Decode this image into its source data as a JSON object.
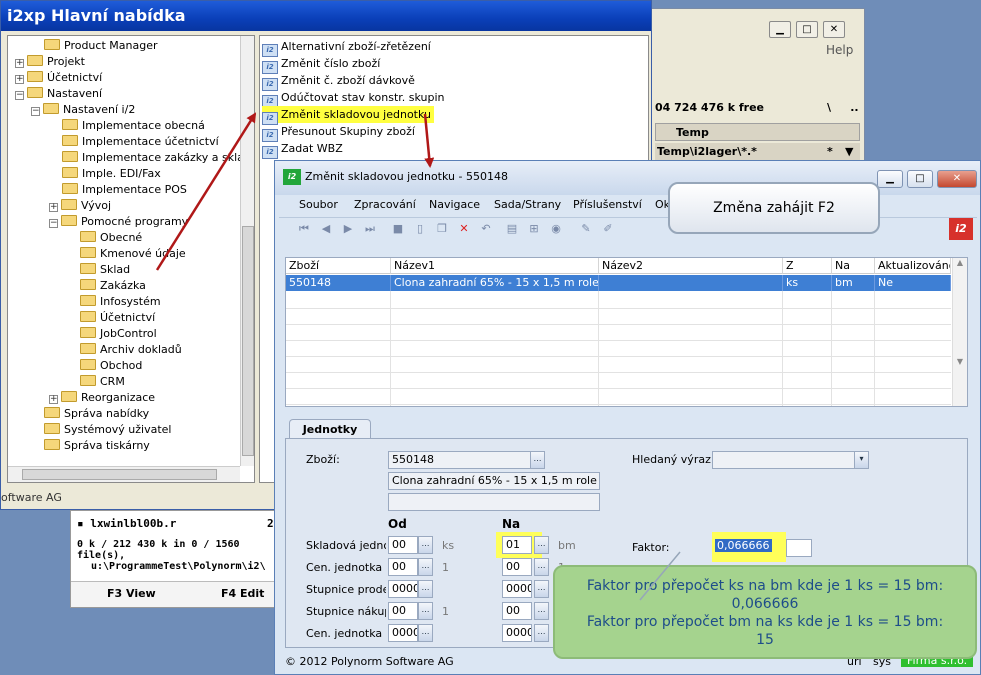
{
  "file_manager": {
    "help": "Help",
    "free_space": "04 724 476 k free",
    "drive_sep": "\\",
    "drive_dots": "..",
    "column_temp": "Temp",
    "path_filter": "Temp\\i2lager\\*.*",
    "path_star": "*",
    "file_name": "lxwinlbl00b.r",
    "file_size": "2",
    "sel_info": "0 k / 212 430 k in 0 / 1560 file(s),",
    "cmd_path": "u:\\ProgrammeTest\\Polynorm\\i2\\",
    "f3": "F3 View",
    "f4": "F4 Edit",
    "status_uri": "uri",
    "status_sys": "sys",
    "status_firma": "Firma s.r.o."
  },
  "menu_window": {
    "title": "i2xp Hlavní nabídka",
    "status": "oftware AG",
    "tree": [
      {
        "label": "Product Manager",
        "level": 2,
        "expander": ""
      },
      {
        "label": "Projekt",
        "level": 1,
        "expander": "+"
      },
      {
        "label": "Účetnictví",
        "level": 1,
        "expander": "+"
      },
      {
        "label": "Nastavení",
        "level": 1,
        "expander": "−"
      },
      {
        "label": "Nastavení i/2",
        "level": 2,
        "expander": "−"
      },
      {
        "label": "Implementace obecná",
        "level": 3,
        "expander": ""
      },
      {
        "label": "Implementace účetnictví",
        "level": 3,
        "expander": ""
      },
      {
        "label": "Implementace zakázky a skla",
        "level": 3,
        "expander": ""
      },
      {
        "label": "Imple. EDI/Fax",
        "level": 3,
        "expander": ""
      },
      {
        "label": "Implementace POS",
        "level": 3,
        "expander": ""
      },
      {
        "label": "Vývoj",
        "level": 3,
        "expander": "+"
      },
      {
        "label": "Pomocné programy",
        "level": 3,
        "expander": "−"
      },
      {
        "label": "Obecné",
        "level": 4,
        "expander": ""
      },
      {
        "label": "Kmenové údaje",
        "level": 4,
        "expander": ""
      },
      {
        "label": "Sklad",
        "level": 4,
        "expander": ""
      },
      {
        "label": "Zakázka",
        "level": 4,
        "expander": ""
      },
      {
        "label": "Infosystém",
        "level": 4,
        "expander": ""
      },
      {
        "label": "Účetnictví",
        "level": 4,
        "expander": ""
      },
      {
        "label": "JobControl",
        "level": 4,
        "expander": ""
      },
      {
        "label": "Archiv dokladů",
        "level": 4,
        "expander": ""
      },
      {
        "label": "Obchod",
        "level": 4,
        "expander": ""
      },
      {
        "label": "CRM",
        "level": 4,
        "expander": ""
      },
      {
        "label": "Reorganizace",
        "level": 3,
        "expander": "+"
      },
      {
        "label": "Správa nabídky",
        "level": 2,
        "expander": ""
      },
      {
        "label": "Systémový uživatel",
        "level": 2,
        "expander": ""
      },
      {
        "label": "Správa tiskárny",
        "level": 2,
        "expander": ""
      }
    ],
    "functions": [
      {
        "label": "Alternativní zboží-zřetězení",
        "selected": false
      },
      {
        "label": "Změnit číslo zboží",
        "selected": false
      },
      {
        "label": "Změnit č. zboží dávkově",
        "selected": false
      },
      {
        "label": "Odúčtovat stav konstr. skupin",
        "selected": false
      },
      {
        "label": "Změnit skladovou jednotku",
        "selected": true
      },
      {
        "label": "Přesunout Skupiny zboží",
        "selected": false
      },
      {
        "label": "Zadat WBZ",
        "selected": false
      }
    ],
    "icon_text": "i2"
  },
  "dialog": {
    "title": "Změnit skladovou jednotku - 550148",
    "logo_text": "i2",
    "menu": [
      "Soubor",
      "Zpracování",
      "Navigace",
      "Sada/Strany",
      "Příslušenství",
      "Okno",
      "?"
    ],
    "grid": {
      "columns": [
        "Zboží",
        "Název1",
        "Název2",
        "Z",
        "Na",
        "Aktualizováno"
      ],
      "rows": [
        [
          "550148",
          "Clona zahradní 65% - 15 x 1,5 m role",
          "",
          "ks",
          "bm",
          "Ne"
        ]
      ]
    },
    "tab_label": "Jednotky",
    "form": {
      "zbozi_label": "Zboží:",
      "zbozi_value": "550148",
      "nazev1": "Clona zahradní 65% - 15 x 1,5 m role",
      "nazev2": "",
      "hledany_label": "Hledaný výraz:",
      "hledany_value": "",
      "col_od": "Od",
      "col_na": "Na",
      "rows": [
        {
          "label": "Skladová jednotka",
          "od": "00",
          "od_unit": "ks",
          "na": "01",
          "na_unit": "bm"
        },
        {
          "label": "Cen. jednotka prodej",
          "od": "00",
          "od_unit": "1",
          "na": "00",
          "na_unit": "1"
        },
        {
          "label": "Stupnice prodej:",
          "od": "0000",
          "od_unit": "",
          "na": "0000",
          "na_unit": ""
        },
        {
          "label": "Stupnice nákup:",
          "od": "00",
          "od_unit": "1",
          "na": "00",
          "na_unit": ""
        },
        {
          "label": "Cen. jednotka nákup",
          "od": "0000",
          "od_unit": "",
          "na": "0000",
          "na_unit": ""
        }
      ],
      "faktor_label": "Faktor:",
      "faktor_value": "0,066666"
    },
    "footer": "© 2012 Polynorm Software AG"
  },
  "callouts": {
    "f2": "Změna zahájit F2",
    "faktor_line1": "Faktor pro přepočet ks na bm kde je 1 ks = 15 bm:",
    "faktor_line2": "0,066666",
    "faktor_line3": "Faktor pro přepočet bm na ks kde je 1 ks = 15 bm:",
    "faktor_line4": "15"
  },
  "colors": {
    "arrow": "#b01818",
    "selection_yellow": "#ffff40",
    "grid_selection": "#3e7fd4",
    "title_blue": "#0a3fb8",
    "callout_green": "#a5d38e"
  }
}
